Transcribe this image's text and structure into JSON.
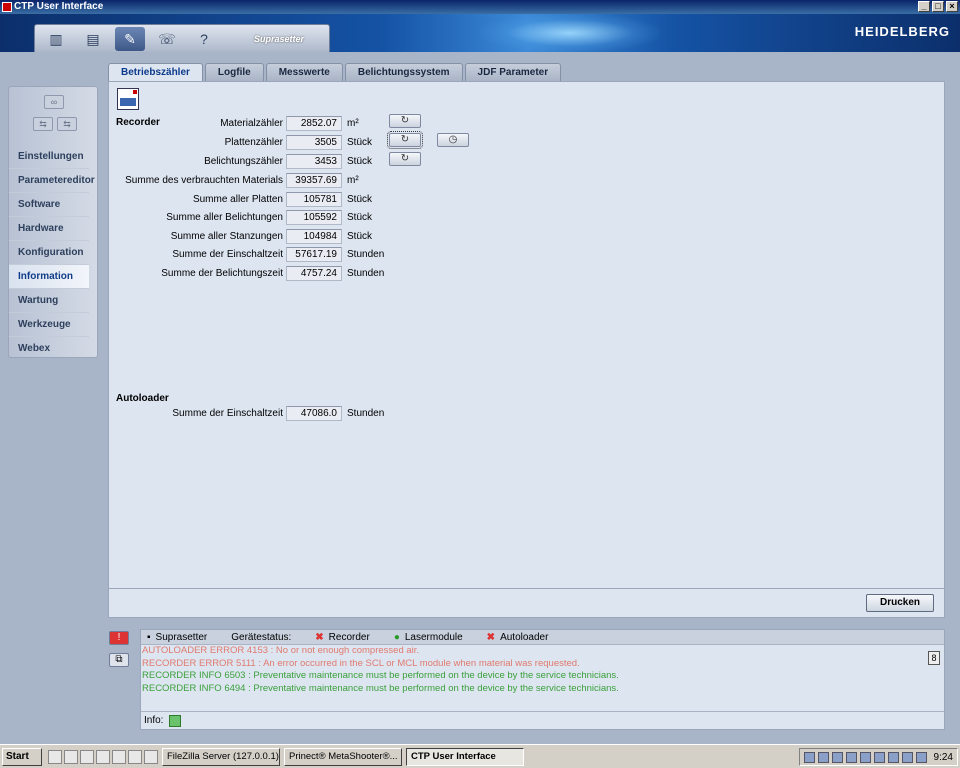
{
  "window": {
    "title": "CTP User Interface"
  },
  "header": {
    "brand": "HEIDELBERG",
    "toolbar_label": "Suprasetter"
  },
  "sidebar": {
    "items": [
      {
        "label": "Einstellungen"
      },
      {
        "label": "Parametereditor"
      },
      {
        "label": "Software"
      },
      {
        "label": "Hardware"
      },
      {
        "label": "Konfiguration"
      },
      {
        "label": "Information"
      },
      {
        "label": "Wartung"
      },
      {
        "label": "Werkzeuge"
      },
      {
        "label": "Webex"
      }
    ],
    "active": "Information"
  },
  "tabs": [
    {
      "label": "Betriebszähler"
    },
    {
      "label": "Logfile"
    },
    {
      "label": "Messwerte"
    },
    {
      "label": "Belichtungssystem"
    },
    {
      "label": "JDF Parameter"
    }
  ],
  "recorder": {
    "title": "Recorder",
    "rows": [
      {
        "label": "Materialzähler",
        "value": "2852.07",
        "unit": "m²"
      },
      {
        "label": "Plattenzähler",
        "value": "3505",
        "unit": "Stück"
      },
      {
        "label": "Belichtungszähler",
        "value": "3453",
        "unit": "Stück"
      },
      {
        "label": "Summe des verbrauchten Materials",
        "value": "39357.69",
        "unit": "m²"
      },
      {
        "label": "Summe aller Platten",
        "value": "105781",
        "unit": "Stück"
      },
      {
        "label": "Summe aller Belichtungen",
        "value": "105592",
        "unit": "Stück"
      },
      {
        "label": "Summe aller Stanzungen",
        "value": "104984",
        "unit": "Stück"
      },
      {
        "label": "Summe der Einschaltzeit",
        "value": "57617.19",
        "unit": "Stunden"
      },
      {
        "label": "Summe der Belichtungszeit",
        "value": "4757.24",
        "unit": "Stunden"
      }
    ]
  },
  "autoloader": {
    "title": "Autoloader",
    "rows": [
      {
        "label": "Summe der Einschaltzeit",
        "value": "47086.0",
        "unit": "Stunden"
      }
    ]
  },
  "print_button": "Drucken",
  "status": {
    "device": "Suprasetter",
    "device_status_label": "Gerätestatus:",
    "recorder": "Recorder",
    "laser": "Lasermodule",
    "autoloader": "Autoloader",
    "messages": [
      {
        "type": "err",
        "text": "AUTOLOADER ERROR 4153 : No or not enough compressed air."
      },
      {
        "type": "err",
        "text": "RECORDER ERROR 5111 : An error occurred in the SCL or MCL module when material was requested."
      },
      {
        "type": "info",
        "text": "RECORDER INFO 6503 : Preventative maintenance must be performed on the device by the service technicians."
      },
      {
        "type": "info",
        "text": "RECORDER INFO 6494 : Preventative maintenance must be performed on the device by the service technicians."
      }
    ],
    "message_count": "8",
    "info_label": "Info:"
  },
  "taskbar": {
    "start": "Start",
    "tasks": [
      {
        "label": "FileZilla Server (127.0.0.1)"
      },
      {
        "label": "Prinect® MetaShooter®..."
      },
      {
        "label": "CTP User Interface"
      }
    ],
    "clock": "9:24"
  }
}
